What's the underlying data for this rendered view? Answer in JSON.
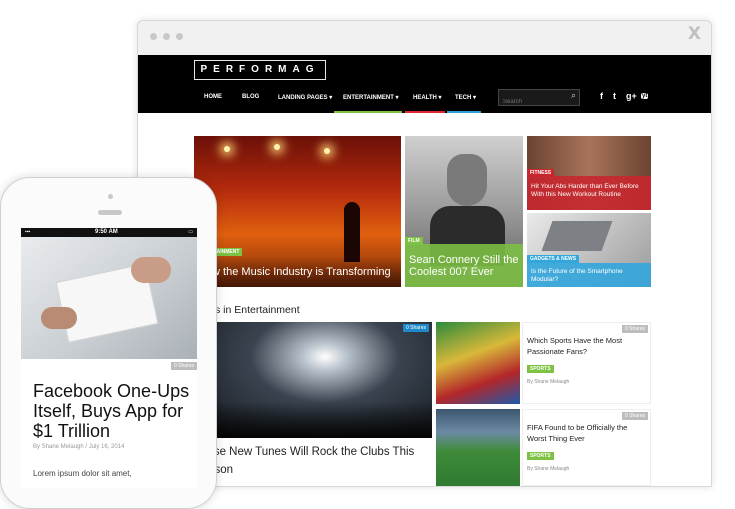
{
  "browser": {
    "close_glyph": "X"
  },
  "site": {
    "logo": "PERFORMAG",
    "nav": [
      "HOME",
      "BLOG",
      "LANDING PAGES",
      "ENTERTAINMENT",
      "HEALTH",
      "TECH"
    ],
    "search_placeholder": "Search",
    "social": [
      "f",
      "t",
      "g+",
      "yt"
    ]
  },
  "featured": [
    {
      "category": "ENTERTAINMENT",
      "title": "How the Music Industry is Transforming"
    },
    {
      "category": "FILM",
      "title": "Sean Connery Still the Coolest 007 Ever"
    },
    {
      "category": "FITNESS",
      "title": "Hit Your Abs Harder than Ever Before With this New Workout Routine"
    },
    {
      "category": "GADGETS & NEWS",
      "title": "Is the Future of the Smartphone Modular?"
    }
  ],
  "section_heading": "Posts in Entertainment",
  "main_post": {
    "shares": "0 Shares",
    "title": "These New Tunes Will Rock the Clubs This Season"
  },
  "side_posts": [
    {
      "shares": "0 Shares",
      "title": "Which Sports Have the Most Passionate Fans?",
      "tag": "SPORTS",
      "byline": "By Shane Melaugh"
    },
    {
      "shares": "0 Shares",
      "title": "FIFA Found to be Officially the Worst Thing Ever",
      "tag": "SPORTS",
      "byline": "By Shane Melaugh"
    }
  ],
  "phone": {
    "time": "9:50 AM",
    "shares": "0 Shares",
    "title": "Facebook One-Ups Itself, Buys App for $1 Trillion",
    "byline": "By Shane Melaugh / July 16, 2014",
    "excerpt": "Lorem ipsum dolor sit amet,"
  },
  "colors": {
    "entertainment": "#7dc243",
    "film": "#7dc243",
    "fitness": "#c8262d",
    "gadgets": "#33a6dc",
    "nav_green": "#7dc243",
    "nav_red": "#e0252d",
    "nav_blue": "#2e9fd6"
  }
}
